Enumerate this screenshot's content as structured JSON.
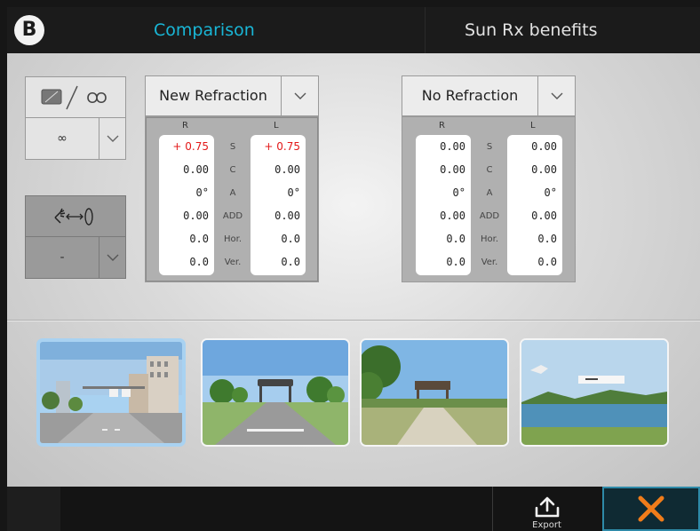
{
  "header": {
    "logo_letter": "B",
    "tabs": [
      {
        "label": "Comparison",
        "active": true
      },
      {
        "label": "Sun Rx benefits",
        "active": false
      }
    ]
  },
  "distance_control": {
    "icon_names": [
      "screen-icon",
      "infinity-icon"
    ],
    "value": "∞"
  },
  "viewer_control": {
    "icon_name": "hand-eye-distance-icon",
    "value": "-"
  },
  "panels": [
    {
      "label": "New Refraction",
      "selected": true,
      "col_r": "R",
      "col_l": "L",
      "rows": [
        {
          "label": "S",
          "r": "+ 0.75",
          "l": "+ 0.75",
          "highlight": true
        },
        {
          "label": "C",
          "r": "0.00",
          "l": "0.00",
          "highlight": false
        },
        {
          "label": "A",
          "r": "0°",
          "l": "0°",
          "highlight": false
        },
        {
          "label": "ADD",
          "r": "0.00",
          "l": "0.00",
          "highlight": false
        },
        {
          "label": "Hor.",
          "r": "0.0",
          "l": "0.0",
          "highlight": false
        },
        {
          "label": "Ver.",
          "r": "0.0",
          "l": "0.0",
          "highlight": false
        }
      ]
    },
    {
      "label": "No Refraction",
      "selected": false,
      "col_r": "R",
      "col_l": "L",
      "rows": [
        {
          "label": "S",
          "r": "0.00",
          "l": "0.00",
          "highlight": false
        },
        {
          "label": "C",
          "r": "0.00",
          "l": "0.00",
          "highlight": false
        },
        {
          "label": "A",
          "r": "0°",
          "l": "0°",
          "highlight": false
        },
        {
          "label": "ADD",
          "r": "0.00",
          "l": "0.00",
          "highlight": false
        },
        {
          "label": "Hor.",
          "r": "0.0",
          "l": "0.0",
          "highlight": false
        },
        {
          "label": "Ver.",
          "r": "0.0",
          "l": "0.0",
          "highlight": false
        }
      ]
    }
  ],
  "scenes": [
    {
      "name": "city-street-scene",
      "active": true
    },
    {
      "name": "road-gate-scene",
      "active": false
    },
    {
      "name": "lakeside-path-scene",
      "active": false
    },
    {
      "name": "lake-bird-scene",
      "active": false
    }
  ],
  "footer": {
    "export_label": "Export",
    "export_icon": "upload-icon",
    "close_icon": "close-icon"
  },
  "colors": {
    "accent": "#19b6d6",
    "highlight_value": "#e31818",
    "close_x": "#f07c1a"
  }
}
